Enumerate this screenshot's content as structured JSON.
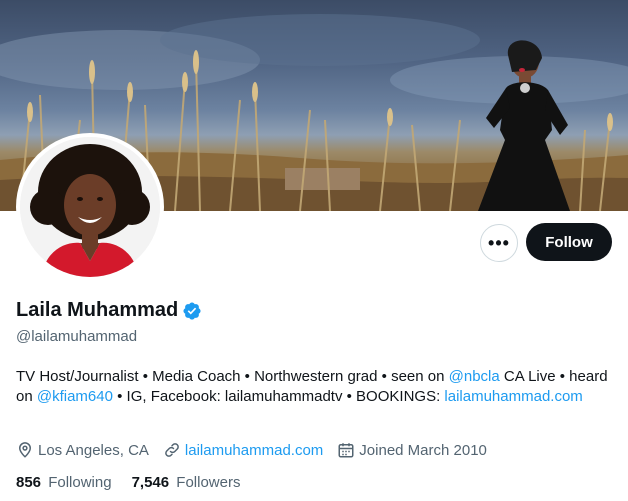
{
  "profile": {
    "display_name": "Laila Muhammad",
    "handle": "@lailamuhammad",
    "verified_icon": "verified-badge-icon",
    "more_label": "•••",
    "follow_label": "Follow"
  },
  "bio": {
    "part1": "TV Host/Journalist • Media Coach • Northwestern grad • seen on ",
    "mention1": "@nbcla",
    "part2": " CA Live • heard on ",
    "mention2": "@kfiam640",
    "part3": " • IG, Facebook: lailamuhammadtv • BOOKINGS: ",
    "link": "lailamuhammad.com"
  },
  "meta": {
    "location": "Los Angeles, CA",
    "website": "lailamuhammad.com",
    "joined": "Joined March 2010"
  },
  "counts": {
    "following_value": "856",
    "following_label": "Following",
    "followers_value": "7,546",
    "followers_label": "Followers"
  },
  "colors": {
    "accent": "#1d9bf0",
    "text": "#0f1419",
    "muted": "#536471",
    "follow_bg": "#0f1419"
  }
}
